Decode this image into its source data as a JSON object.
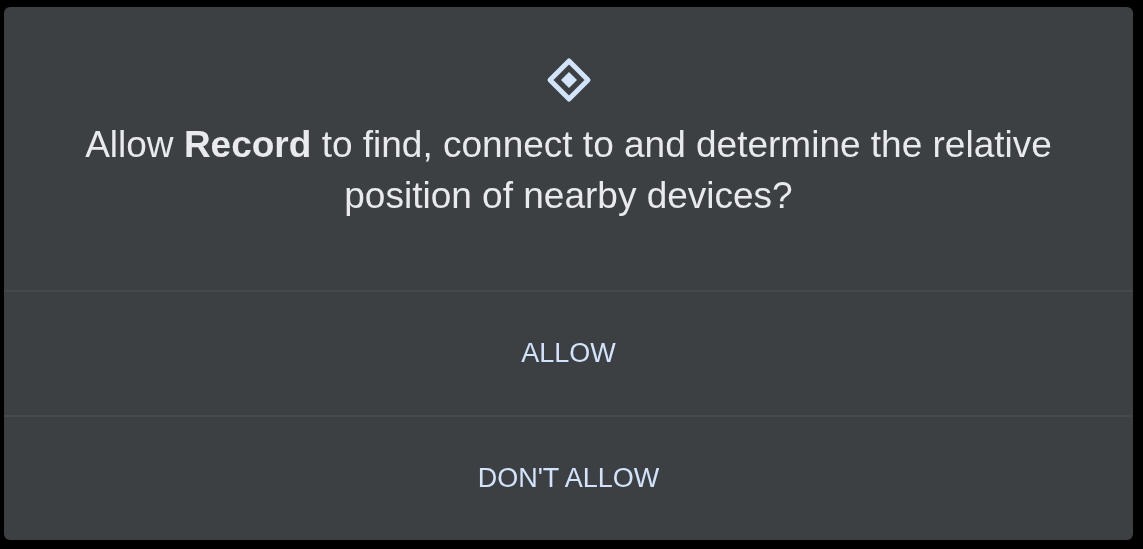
{
  "dialog": {
    "title": "Allow **Record** to find, connect to and determine the relative position of nearby devices?",
    "buttons": [
      "ALLOW",
      "DON'T ALLOW"
    ]
  }
}
